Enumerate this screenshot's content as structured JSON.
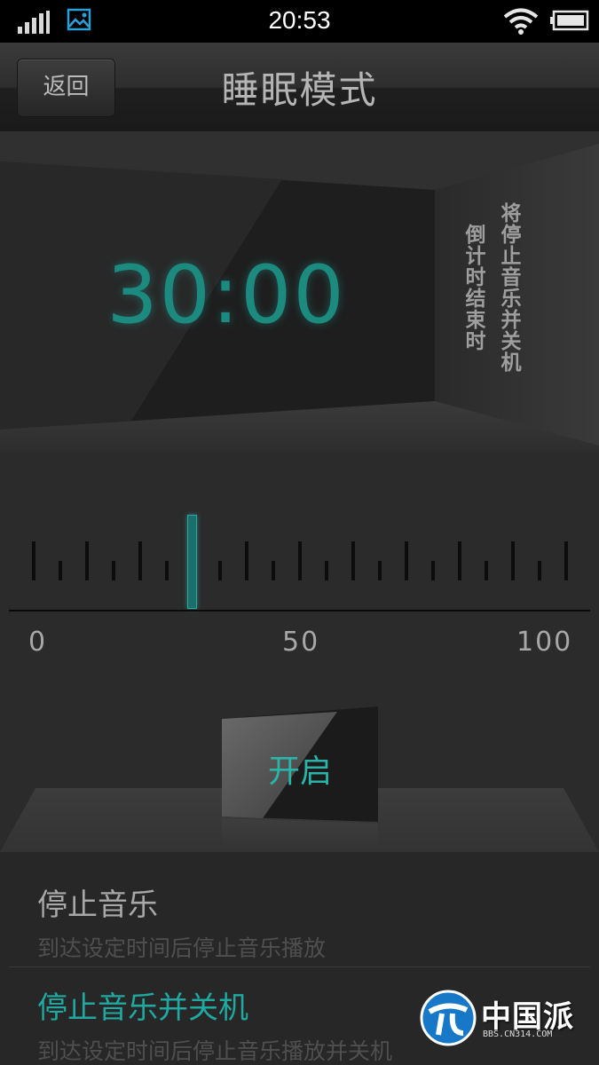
{
  "status_bar": {
    "time": "20:53",
    "icons": [
      "signal-icon",
      "gallery-icon",
      "wifi-icon",
      "battery-icon"
    ]
  },
  "header": {
    "back_label": "返回",
    "title": "睡眠模式"
  },
  "timer": {
    "display": "30:00",
    "side_text_line1": "将停止音乐并关机",
    "side_text_line2": "倒计时结束时"
  },
  "slider": {
    "min_label": "0",
    "mid_label": "50",
    "max_label": "100",
    "value": 30,
    "min": 0,
    "max": 100
  },
  "start_button": {
    "label": "开启"
  },
  "options": [
    {
      "title": "停止音乐",
      "description": "到达设定时间后停止音乐播放",
      "selected": false
    },
    {
      "title": "停止音乐并关机",
      "description": "到达设定时间后停止音乐播放并关机",
      "selected": true
    }
  ],
  "watermark": {
    "text": "中国派",
    "sub": "BBS.CN314.COM"
  },
  "colors": {
    "accent": "#1fa9a0",
    "timer": "#1d8a80",
    "background": "#2b2b2b"
  }
}
